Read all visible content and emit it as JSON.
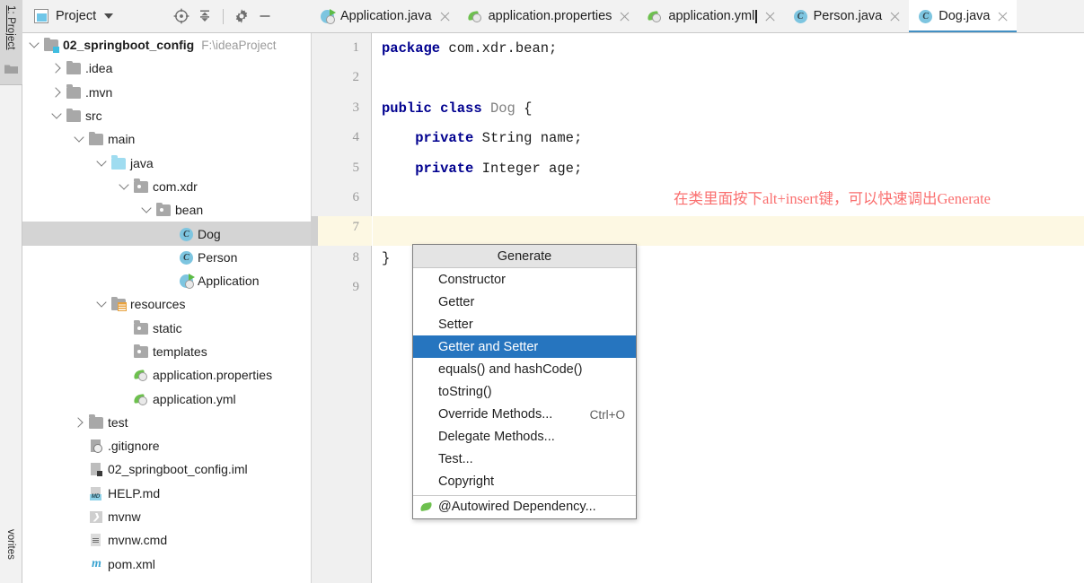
{
  "left_strip": {
    "project_label": "1: Project",
    "favorites_label": "vorites",
    "folder_icon": "folder-icon"
  },
  "project_toolbar": {
    "title": "Project",
    "window_icon": "project-window-icon",
    "caret_icon": "chevron-down-icon",
    "buttons": [
      {
        "name": "locate-in-tree-button",
        "icon": "crosshair-target-icon"
      },
      {
        "name": "collapse-all-button",
        "icon": "collapse-all-icon"
      },
      {
        "name": "settings-button",
        "icon": "gear-icon"
      },
      {
        "name": "hide-panel-button",
        "icon": "minus-icon"
      }
    ]
  },
  "tree": [
    {
      "label": "02_springboot_config",
      "sub": "F:\\ideaProject",
      "indent": 0,
      "twisty": "open",
      "icon": "project-root-icon",
      "bold": true,
      "selected": false
    },
    {
      "label": ".idea",
      "sub": "",
      "indent": 1,
      "twisty": "closed",
      "icon": "folder-icon",
      "bold": false,
      "selected": false
    },
    {
      "label": ".mvn",
      "sub": "",
      "indent": 1,
      "twisty": "closed",
      "icon": "folder-icon",
      "bold": false,
      "selected": false
    },
    {
      "label": "src",
      "sub": "",
      "indent": 1,
      "twisty": "open",
      "icon": "folder-icon",
      "bold": false,
      "selected": false
    },
    {
      "label": "main",
      "sub": "",
      "indent": 2,
      "twisty": "open",
      "icon": "folder-icon",
      "bold": false,
      "selected": false
    },
    {
      "label": "java",
      "sub": "",
      "indent": 3,
      "twisty": "open",
      "icon": "source-root-folder-icon",
      "bold": false,
      "selected": false
    },
    {
      "label": "com.xdr",
      "sub": "",
      "indent": 4,
      "twisty": "open",
      "icon": "package-icon",
      "bold": false,
      "selected": false
    },
    {
      "label": "bean",
      "sub": "",
      "indent": 5,
      "twisty": "open",
      "icon": "package-icon",
      "bold": false,
      "selected": false
    },
    {
      "label": "Dog",
      "sub": "",
      "indent": 6,
      "twisty": "none",
      "icon": "java-class-icon",
      "bold": false,
      "selected": true
    },
    {
      "label": "Person",
      "sub": "",
      "indent": 6,
      "twisty": "none",
      "icon": "java-class-icon",
      "bold": false,
      "selected": false
    },
    {
      "label": "Application",
      "sub": "",
      "indent": 6,
      "twisty": "none",
      "icon": "spring-boot-app-icon",
      "bold": false,
      "selected": false
    },
    {
      "label": "resources",
      "sub": "",
      "indent": 3,
      "twisty": "open",
      "icon": "resources-root-folder-icon",
      "bold": false,
      "selected": false
    },
    {
      "label": "static",
      "sub": "",
      "indent": 4,
      "twisty": "none",
      "icon": "package-icon",
      "bold": false,
      "selected": false
    },
    {
      "label": "templates",
      "sub": "",
      "indent": 4,
      "twisty": "none",
      "icon": "package-icon",
      "bold": false,
      "selected": false
    },
    {
      "label": "application.properties",
      "sub": "",
      "indent": 4,
      "twisty": "none",
      "icon": "spring-leaf-icon",
      "bold": false,
      "selected": false
    },
    {
      "label": "application.yml",
      "sub": "",
      "indent": 4,
      "twisty": "none",
      "icon": "spring-leaf-icon",
      "bold": false,
      "selected": false
    },
    {
      "label": "test",
      "sub": "",
      "indent": 2,
      "twisty": "closed",
      "icon": "folder-icon",
      "bold": false,
      "selected": false
    },
    {
      "label": ".gitignore",
      "sub": "",
      "indent": 2,
      "twisty": "none",
      "icon": "gitignore-file-icon",
      "bold": false,
      "selected": false
    },
    {
      "label": "02_springboot_config.iml",
      "sub": "",
      "indent": 2,
      "twisty": "none",
      "icon": "iml-file-icon",
      "bold": false,
      "selected": false
    },
    {
      "label": "HELP.md",
      "sub": "",
      "indent": 2,
      "twisty": "none",
      "icon": "markdown-file-icon",
      "bold": false,
      "selected": false
    },
    {
      "label": "mvnw",
      "sub": "",
      "indent": 2,
      "twisty": "none",
      "icon": "shell-script-icon",
      "bold": false,
      "selected": false
    },
    {
      "label": "mvnw.cmd",
      "sub": "",
      "indent": 2,
      "twisty": "none",
      "icon": "cmd-file-icon",
      "bold": false,
      "selected": false
    },
    {
      "label": "pom.xml",
      "sub": "",
      "indent": 2,
      "twisty": "none",
      "icon": "maven-file-icon",
      "bold": false,
      "selected": false
    }
  ],
  "tabs": [
    {
      "label": "Application.java",
      "icon": "spring-boot-app-icon",
      "active": false,
      "modified": false
    },
    {
      "label": "application.properties",
      "icon": "spring-leaf-icon",
      "active": false,
      "modified": false
    },
    {
      "label": "application.yml",
      "icon": "spring-leaf-icon",
      "active": false,
      "modified": true
    },
    {
      "label": "Person.java",
      "icon": "java-class-icon",
      "active": false,
      "modified": false
    },
    {
      "label": "Dog.java",
      "icon": "java-class-icon",
      "active": true,
      "modified": false
    }
  ],
  "editor": {
    "line_numbers": [
      "1",
      "2",
      "3",
      "4",
      "5",
      "6",
      "7",
      "8",
      "9"
    ],
    "current_line": 7,
    "lines": [
      {
        "n": 1,
        "segments": [
          {
            "t": "package",
            "c": "kw"
          },
          {
            "t": " com.xdr.bean;",
            "c": "plain"
          }
        ]
      },
      {
        "n": 2,
        "segments": []
      },
      {
        "n": 3,
        "segments": [
          {
            "t": "public class",
            "c": "kw"
          },
          {
            "t": " ",
            "c": "plain"
          },
          {
            "t": "Dog",
            "c": "cls"
          },
          {
            "t": " {",
            "c": "plain"
          }
        ]
      },
      {
        "n": 4,
        "segments": [
          {
            "t": "    ",
            "c": "plain"
          },
          {
            "t": "private",
            "c": "kw"
          },
          {
            "t": " String name;",
            "c": "plain"
          }
        ]
      },
      {
        "n": 5,
        "segments": [
          {
            "t": "    ",
            "c": "plain"
          },
          {
            "t": "private",
            "c": "kw"
          },
          {
            "t": " Integer age;",
            "c": "plain"
          }
        ]
      },
      {
        "n": 6,
        "segments": []
      },
      {
        "n": 7,
        "segments": []
      },
      {
        "n": 8,
        "segments": [
          {
            "t": "}",
            "c": "plain"
          }
        ]
      },
      {
        "n": 9,
        "segments": []
      }
    ],
    "annotation": "在类里面按下alt+insert键，可以快速调出Generate",
    "annotation_color": "#fa6f6f",
    "current_line_highlight_color": "#fdf8e3"
  },
  "generate_popup": {
    "title": "Generate",
    "selected_color": "#2675bf",
    "items": [
      {
        "label": "Constructor",
        "shortcut": "",
        "selected": false,
        "icon": ""
      },
      {
        "label": "Getter",
        "shortcut": "",
        "selected": false,
        "icon": ""
      },
      {
        "label": "Setter",
        "shortcut": "",
        "selected": false,
        "icon": ""
      },
      {
        "label": "Getter and Setter",
        "shortcut": "",
        "selected": true,
        "icon": ""
      },
      {
        "label": "equals() and hashCode()",
        "shortcut": "",
        "selected": false,
        "icon": ""
      },
      {
        "label": "toString()",
        "shortcut": "",
        "selected": false,
        "icon": ""
      },
      {
        "label": "Override Methods...",
        "shortcut": "Ctrl+O",
        "selected": false,
        "icon": ""
      },
      {
        "label": "Delegate Methods...",
        "shortcut": "",
        "selected": false,
        "icon": ""
      },
      {
        "label": "Test...",
        "shortcut": "",
        "selected": false,
        "icon": ""
      },
      {
        "label": "Copyright",
        "shortcut": "",
        "selected": false,
        "icon": ""
      }
    ],
    "footer_item": {
      "label": "@Autowired Dependency...",
      "icon": "spring-leaf-icon"
    }
  }
}
